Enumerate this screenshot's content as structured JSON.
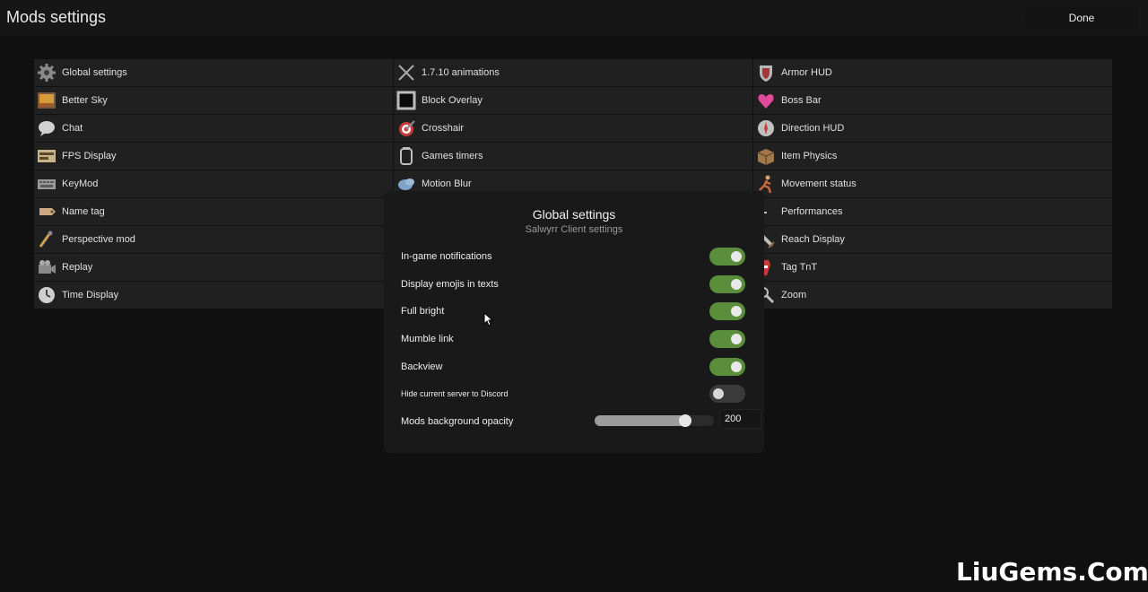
{
  "header": {
    "title": "Mods settings",
    "done_label": "Done"
  },
  "mods": {
    "columns": [
      [
        {
          "label": "Global settings",
          "icon": "gear-icon"
        },
        {
          "label": "Better Sky",
          "icon": "sky-icon"
        },
        {
          "label": "Chat",
          "icon": "chat-bubble-icon"
        },
        {
          "label": "FPS Display",
          "icon": "fps-meter-icon"
        },
        {
          "label": "KeyMod",
          "icon": "keyboard-icon"
        },
        {
          "label": "Name tag",
          "icon": "name-tag-icon"
        },
        {
          "label": "Perspective mod",
          "icon": "perspective-icon"
        },
        {
          "label": "Replay",
          "icon": "camera-icon"
        },
        {
          "label": "Time Display",
          "icon": "clock-icon"
        }
      ],
      [
        {
          "label": "1.7.10 animations",
          "icon": "crossed-swords-icon"
        },
        {
          "label": "Block Overlay",
          "icon": "block-outline-icon"
        },
        {
          "label": "Crosshair",
          "icon": "target-icon"
        },
        {
          "label": "Games timers",
          "icon": "jar-icon"
        },
        {
          "label": "Motion Blur",
          "icon": "blur-cloud-icon"
        }
      ],
      [
        {
          "label": "Armor HUD",
          "icon": "shield-icon"
        },
        {
          "label": "Boss Bar",
          "icon": "heart-icon"
        },
        {
          "label": "Direction HUD",
          "icon": "compass-icon"
        },
        {
          "label": "Item Physics",
          "icon": "box-icon"
        },
        {
          "label": "Movement status",
          "icon": "running-icon"
        },
        {
          "label": "Performances",
          "icon": "dash-icon"
        },
        {
          "label": "Reach Display",
          "icon": "sword-icon"
        },
        {
          "label": "Tag TnT",
          "icon": "tnt-tag-icon"
        },
        {
          "label": "Zoom",
          "icon": "magnifier-icon"
        }
      ]
    ]
  },
  "global_settings": {
    "title": "Global settings",
    "subtitle": "Salwyrr Client settings",
    "toggles": [
      {
        "label": "In-game notifications",
        "enabled": true
      },
      {
        "label": "Display emojis in texts",
        "enabled": true
      },
      {
        "label": "Full bright",
        "enabled": true
      },
      {
        "label": "Mumble link",
        "enabled": true
      },
      {
        "label": "Backview",
        "enabled": true
      },
      {
        "label": "Hide current server to Discord",
        "enabled": false
      }
    ],
    "opacity": {
      "label": "Mods background opacity",
      "value": "200",
      "fraction": 0.76
    }
  },
  "colors": {
    "toggle_on": "#5a8e3a",
    "toggle_off": "#3a3a3a",
    "panel": "#202020"
  },
  "watermark": "LiuGems.Com"
}
